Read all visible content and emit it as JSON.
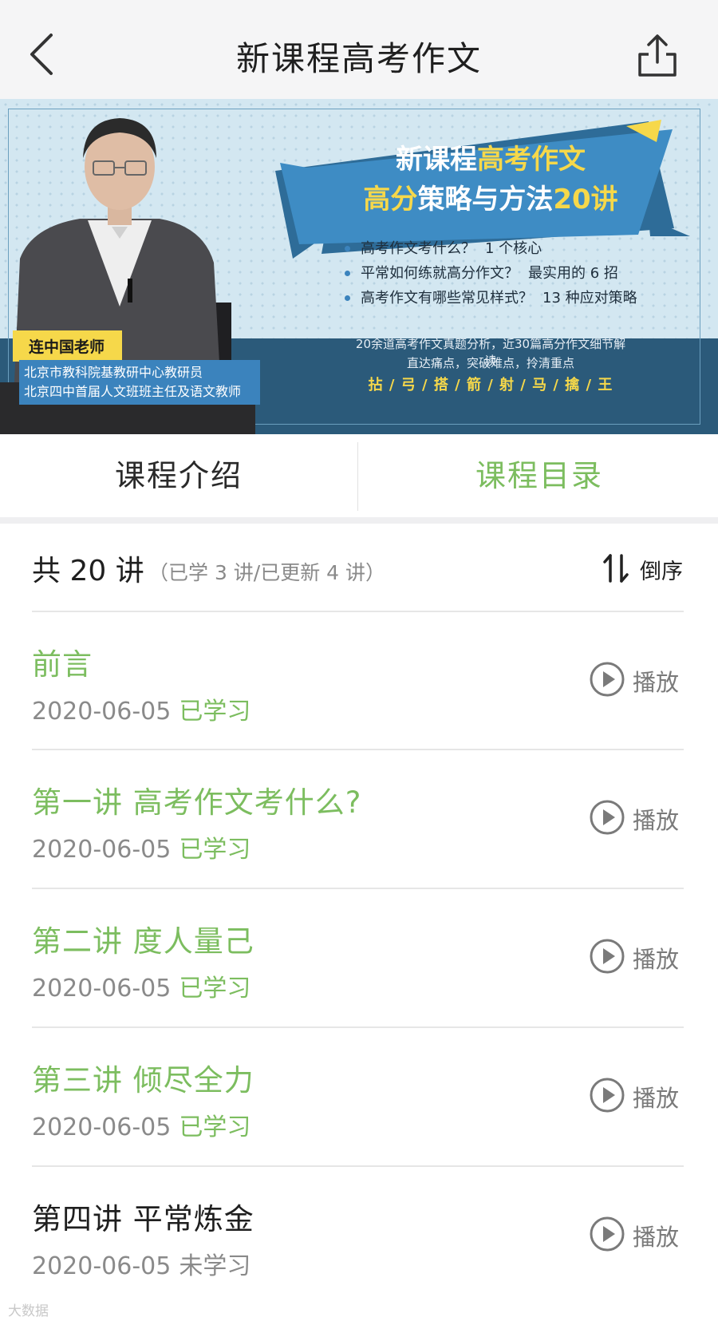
{
  "nav": {
    "title": "新课程高考作文",
    "back_icon": "chevron-left-icon",
    "share_icon": "share-icon"
  },
  "banner": {
    "teacher_name": "连中国老师",
    "teacher_desc_1": "北京市教科院基教研中心教研员",
    "teacher_desc_2": "北京四中首届人文班班主任及语文教师",
    "headline_1a": "新课程",
    "headline_1b": "高考作文",
    "headline_2a": "高分",
    "headline_2b": "策略与方法",
    "headline_2c": "20讲",
    "bullets": [
      {
        "text": "高考作文考什么？",
        "em": "1 个核心"
      },
      {
        "text": "平常如何练就高分作文？",
        "em": "最实用的 6 招"
      },
      {
        "text": "高考作文有哪些常见样式？",
        "em": "13 种应对策略"
      }
    ],
    "desc_1": "20余道高考作文真题分析，近30篇高分作文细节解读",
    "desc_2": "直达痛点，突破难点，拎清重点",
    "slogan": "拈 / 弓 / 搭 / 箭 / 射 / 马 / 擒 / 王"
  },
  "tabs": {
    "intro": "课程介绍",
    "catalog": "课程目录",
    "active": "catalog"
  },
  "summary": {
    "total": "共 20 讲",
    "sub": "（已学 3 讲/已更新 4 讲）",
    "sort_label": "倒序",
    "sort_icon": "sort-icon"
  },
  "lessons": [
    {
      "title": "前言",
      "date": "2020-06-05",
      "status": "已学习",
      "studied": true,
      "play_label": "播放"
    },
    {
      "title": "第一讲 高考作文考什么?",
      "date": "2020-06-05",
      "status": "已学习",
      "studied": true,
      "play_label": "播放"
    },
    {
      "title": "第二讲 度人量己",
      "date": "2020-06-05",
      "status": "已学习",
      "studied": true,
      "play_label": "播放"
    },
    {
      "title": "第三讲 倾尽全力",
      "date": "2020-06-05",
      "status": "已学习",
      "studied": true,
      "play_label": "播放"
    },
    {
      "title": "第四讲 平常炼金",
      "date": "2020-06-05",
      "status": "未学习",
      "studied": false,
      "play_label": "播放"
    }
  ],
  "watermark": "大数据",
  "colors": {
    "accent_green": "#7cbd5f",
    "banner_blue": "#3b83bd",
    "banner_dark": "#2b5a7a",
    "banner_yellow": "#f6d84a"
  }
}
